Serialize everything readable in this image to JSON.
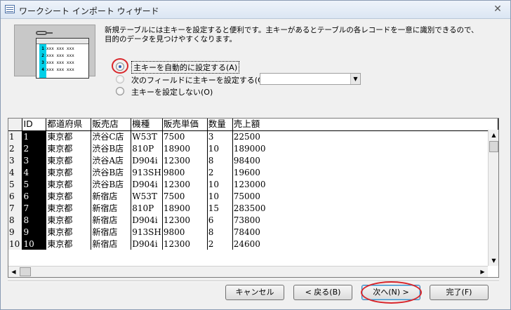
{
  "window": {
    "title": "ワークシート インポート ウィザード",
    "close_glyph": "✕"
  },
  "illustration": {
    "rows": [
      {
        "n": "1",
        "text": "xxx xxx xxx"
      },
      {
        "n": "2",
        "text": "xxx xxx xxx"
      },
      {
        "n": "3",
        "text": "xxx xxx xxx"
      },
      {
        "n": "4",
        "text": "xxx xxx xxx"
      }
    ]
  },
  "description": "新規テーブルには主キーを設定すると便利です。主キーがあるとテーブルの各レコードを一意に識別できるので、目的のデータを見つけやすくなります。",
  "options": {
    "auto": "主キーを自動的に設定する(A)",
    "field": "次のフィールドに主キーを設定する(C)",
    "none": "主キーを設定しない(O)",
    "selected": "auto"
  },
  "field_combo": {
    "value": "",
    "arrow": "▼"
  },
  "grid": {
    "columns": [
      "ID",
      "都道府県",
      "販売店",
      "機種",
      "販売単価",
      "数量",
      "売上額"
    ],
    "rows": [
      [
        "1",
        "1",
        "東京都",
        "渋谷C店",
        "W53T",
        "7500",
        "3",
        "22500"
      ],
      [
        "2",
        "2",
        "東京都",
        "渋谷B店",
        "810P",
        "18900",
        "10",
        "189000"
      ],
      [
        "3",
        "3",
        "東京都",
        "渋谷A店",
        "D904i",
        "12300",
        "8",
        "98400"
      ],
      [
        "4",
        "4",
        "東京都",
        "渋谷B店",
        "913SH",
        "9800",
        "2",
        "19600"
      ],
      [
        "5",
        "5",
        "東京都",
        "渋谷B店",
        "D904i",
        "12300",
        "10",
        "123000"
      ],
      [
        "6",
        "6",
        "東京都",
        "新宿店",
        "W53T",
        "7500",
        "10",
        "75000"
      ],
      [
        "7",
        "7",
        "東京都",
        "新宿店",
        "810P",
        "18900",
        "15",
        "283500"
      ],
      [
        "8",
        "8",
        "東京都",
        "新宿店",
        "D904i",
        "12300",
        "6",
        "73800"
      ],
      [
        "9",
        "9",
        "東京都",
        "新宿店",
        "913SH",
        "9800",
        "8",
        "78400"
      ],
      [
        "10",
        "10",
        "東京都",
        "新宿店",
        "D904i",
        "12300",
        "2",
        "24600"
      ]
    ]
  },
  "scroll": {
    "up": "▲",
    "down": "▼",
    "left": "◀",
    "right": "▶"
  },
  "buttons": {
    "cancel": "キャンセル",
    "back": "< 戻る(B)",
    "next": "次へ(N) >",
    "finish": "完了(F)"
  },
  "colors": {
    "highlight": "#d9262b",
    "key_column": "#00d0e8"
  }
}
